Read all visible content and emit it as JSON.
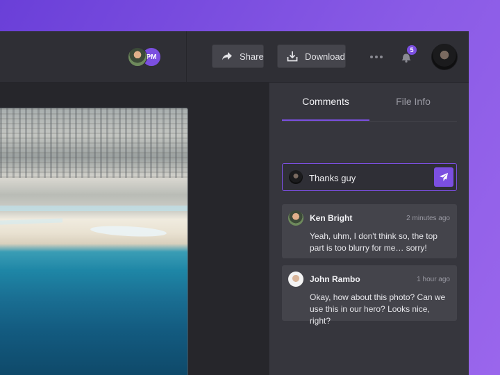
{
  "header": {
    "collaborator_initials": "PM",
    "share_label": "Share",
    "download_label": "Download",
    "notification_count": "5"
  },
  "sidebar": {
    "tabs": [
      {
        "label": "Comments",
        "active": true
      },
      {
        "label": "File Info",
        "active": false
      }
    ],
    "comment_input": {
      "value": "Thanks guy"
    },
    "comments": [
      {
        "author": "Ken Bright",
        "time": "2 minutes ago",
        "text": "Yeah, uhm, I don't think so, the top part is too blurry for me… sorry!"
      },
      {
        "author": "John Rambo",
        "time": "1 hour ago",
        "text": "Okay, how about this photo? Can we use this in our hero? Looks nice, right?"
      }
    ]
  },
  "icons": {
    "share": "share-arrow-icon",
    "download": "download-icon",
    "more": "more-horizontal-icon",
    "notifications": "bell-icon",
    "send": "send-paper-plane-icon"
  },
  "colors": {
    "accent": "#7b4fe0",
    "background_gradient_start": "#6a3fd8",
    "background_gradient_end": "#9a66ec",
    "app_bg": "#2b2b31",
    "sidebar_bg": "#36363d",
    "card_bg": "#44444b"
  }
}
